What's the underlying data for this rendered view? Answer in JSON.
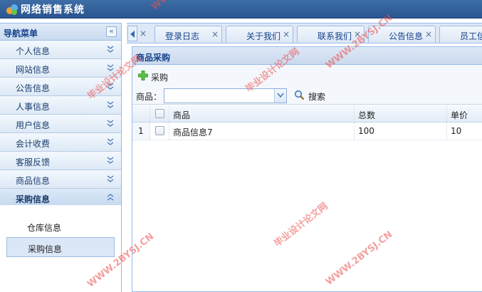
{
  "app": {
    "title": "网络销售系统"
  },
  "sidebar": {
    "header": "导航菜单",
    "collapse_glyph": "«",
    "items": [
      {
        "label": "个人信息"
      },
      {
        "label": "网站信息"
      },
      {
        "label": "公告信息"
      },
      {
        "label": "人事信息"
      },
      {
        "label": "用户信息"
      },
      {
        "label": "会计收费"
      },
      {
        "label": "客服反馈"
      },
      {
        "label": "商品信息"
      },
      {
        "label": "采购信息",
        "expanded": true
      }
    ],
    "submenu": [
      {
        "label": "仓库信息"
      },
      {
        "label": "采购信息",
        "selected": true
      }
    ]
  },
  "tabs": [
    {
      "label": "登录日志",
      "close": "×"
    },
    {
      "label": "关于我们",
      "close": "×"
    },
    {
      "label": "联系我们",
      "close": "×"
    },
    {
      "label": "公告信息",
      "close": "×"
    },
    {
      "label": "员工信",
      "close": ""
    }
  ],
  "first_tab_close": "×",
  "panel": {
    "title": "商品采购",
    "add_label": "采购",
    "filter_label": "商品：",
    "select_value": "",
    "search_label": "搜索"
  },
  "grid": {
    "columns": {
      "product": "商品",
      "total": "总数",
      "price": "单价"
    },
    "rows": [
      {
        "num": "1",
        "product": "商品信息7",
        "total": "100",
        "price": "10"
      }
    ]
  },
  "watermarks": {
    "url": "WWW.2BYSJ.CN",
    "cn": "毕业设计论文网"
  },
  "colors": {
    "titlebar": "#2f5f99",
    "panel_border": "#99bbe8",
    "accent": "#15428b",
    "add_green": "#3a9a2a"
  }
}
